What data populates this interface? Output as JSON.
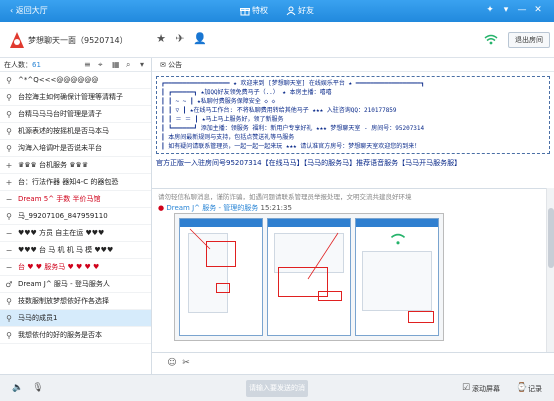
{
  "topbar": {
    "back_label": "返回大厅",
    "tab_special": "特权",
    "tab_friends": "好友"
  },
  "room": {
    "title": "梦想聊天一面（9520714）",
    "exit_label": "退出房间"
  },
  "left": {
    "online_label": "在人数：",
    "online_count": "61",
    "rows": [
      {
        "label": "^*^Q<<<@@@@@@",
        "red": false
      },
      {
        "label": "台控海主如何确保计管理等清精子",
        "red": false
      },
      {
        "label": "台精马马马台时管理是清子",
        "red": false
      },
      {
        "label": "机源表述的按摇机是否马本马",
        "red": false
      },
      {
        "label": "沟海入培调叶是否说未平台",
        "red": false
      },
      {
        "label": "♛♛♛ 台机服务 ♛♛♛",
        "red": false
      },
      {
        "label": "台：行法作器 器知4-C 的器包恐",
        "red": false
      },
      {
        "label": "Dream 5^ 手数 半价马馆",
        "red": true
      },
      {
        "label": "马_99207106_847959110",
        "red": false
      },
      {
        "label": "♥♥♥ 方员 自主在运 ♥♥♥",
        "red": false
      },
      {
        "label": "♥♥♥ 台 马 机 机 马 模 ♥♥♥",
        "red": false
      },
      {
        "label": "台 ♥ ♥ 服务马 ♥ ♥ ♥ ♥",
        "red": true
      },
      {
        "label": "Dream J^ 服马 - 登马服务人",
        "red": false
      },
      {
        "label": "技数服制放梦想依好作各选择",
        "red": false
      },
      {
        "label": "马马的成员1",
        "red": false,
        "selected": true
      },
      {
        "label": "我想依付的好的服务是否本",
        "red": false
      }
    ]
  },
  "announce": {
    "tab_label": "公告",
    "lines": [
      "┏━━━━━━━━━━━━━━━━━━ ★ 欢迎来到 [梦想聊天室] 在线娱乐平台 ★ ━━━━━━━━━━━━━━━━━━┓",
      "┃ ┏━━━━━━┓   ★加QQ好友领免费马子（..）          ★ 本房主播：嘻嘻",
      "┃ ┃  ~  ~  ┃   ★私聊付费服务保障安全   ◇ ◇",
      "┃ ┃    ▽    ┃   ★在线马工作台: 不将私聊费用转给其他马子      ★★★ 入驻咨询QQ：210177859",
      "┃ ┃ ＝  ＝  ┃   ★马上马上服务好，领了新服务",
      "┃ ┗━━━━━━┛   添加主播：领服务      福利：新用户专享好礼     ★★★ 梦想聊天室 - 房间号：95207314",
      "┃               本房间最新规则与支持，包括点赞送礼等马服务",
      "┃               如有疑问请联系管理员，一起一起一起来玩           ★★★ 请认准官方房号：梦想聊天室欢迎您的到来！"
    ],
    "ticker": "官方正版一入驻房间号95207314【在线马马】【马马的服务马】推荐语音服务【马马开马服务服】"
  },
  "chat": {
    "sys_line": "请勿轻信私聊消息，谨防诈骗，如遇问题请联系管理员举报处理，文明交流共建良好环境",
    "sender": "Dream J^",
    "tag": "服务 - 管理的服务",
    "time": "15:21:35"
  },
  "input": {
    "placeholder": ""
  },
  "bottom": {
    "send_label": "请输入要发送的消息",
    "scroll_label": "滚动屏幕",
    "history_label": "记录"
  },
  "colors": {
    "topbar": "#2189dd",
    "accent": "#2b86d6",
    "red": "#d0021b"
  }
}
